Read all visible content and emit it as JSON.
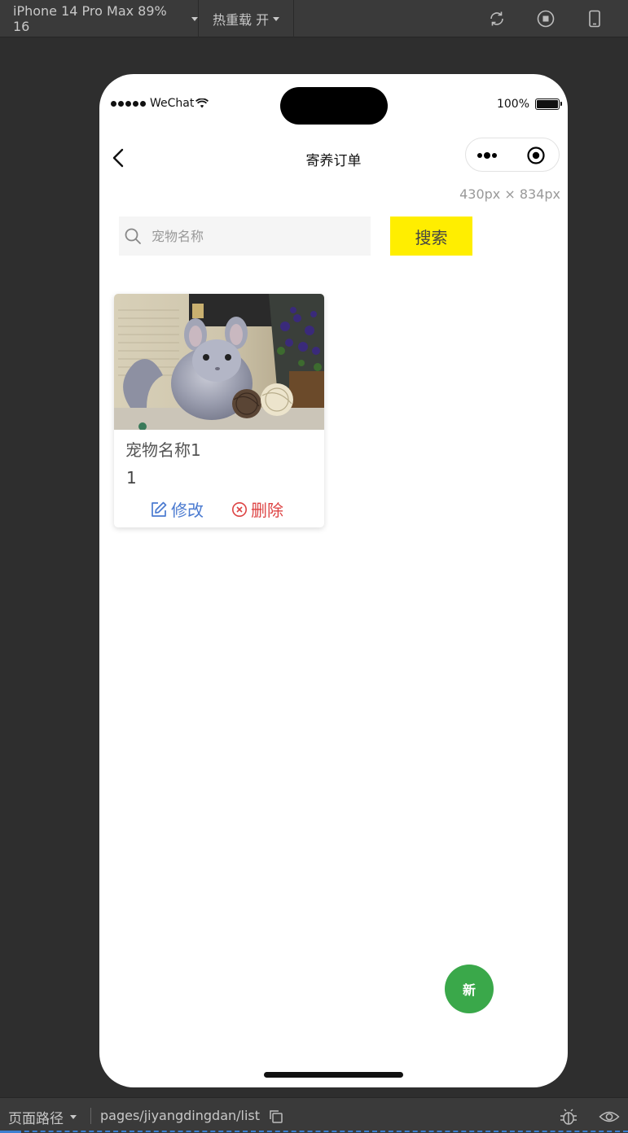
{
  "devtools": {
    "device_label": "iPhone 14 Pro Max 89% 16",
    "hotreload_label": "热重载 开",
    "icons": [
      "refresh-icon",
      "stop-icon",
      "phone-icon"
    ]
  },
  "status_bar": {
    "carrier": "WeChat",
    "battery": "100%"
  },
  "nav": {
    "title": "寄养订单"
  },
  "size_hint": "430px × 834px",
  "search": {
    "placeholder": "宠物名称",
    "button_label": "搜索"
  },
  "cards": [
    {
      "title": "宠物名称1",
      "number": "1",
      "edit_label": "修改",
      "delete_label": "删除"
    }
  ],
  "fab": {
    "label": "新"
  },
  "bottom_bar": {
    "label": "页面路径",
    "path": "pages/jiyangdingdan/list"
  },
  "colors": {
    "search_button": "#ffee00",
    "fab": "#3aa84a",
    "edit": "#4a7ad0",
    "delete": "#dd4444"
  }
}
